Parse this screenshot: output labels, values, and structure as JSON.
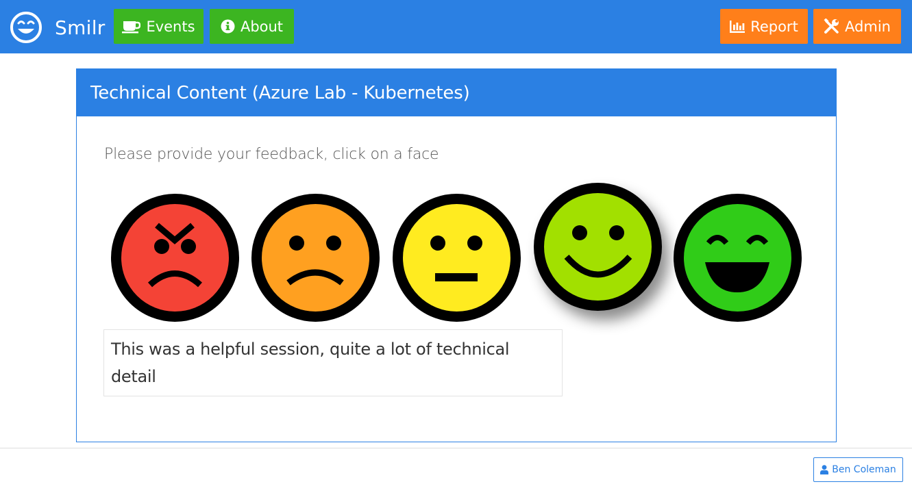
{
  "navbar": {
    "brand": "Smilr",
    "brand_logo_icon": "smiley-logo-icon",
    "buttons": {
      "events": {
        "label": "Events",
        "icon": "coffee-cup-icon"
      },
      "about": {
        "label": "About",
        "icon": "info-circle-icon"
      },
      "report": {
        "label": "Report",
        "icon": "bar-chart-icon"
      },
      "admin": {
        "label": "Admin",
        "icon": "tools-icon"
      }
    }
  },
  "card": {
    "title": "Technical Content (Azure Lab - Kubernetes)",
    "prompt": "Please provide your feedback, click on a face",
    "faces": [
      {
        "name": "angry",
        "color": "#f44336"
      },
      {
        "name": "sad",
        "color": "#ffa020"
      },
      {
        "name": "neutral",
        "color": "#ffeb20"
      },
      {
        "name": "happy",
        "color": "#a2e000",
        "selected": true
      },
      {
        "name": "very-happy",
        "color": "#30cc18"
      }
    ],
    "comment": "This was a helpful session, quite a lot of technical detail"
  },
  "footer": {
    "user_label": "Ben Coleman",
    "user_icon": "user-icon"
  },
  "colors": {
    "primary": "#2b80e3",
    "success": "#3cb521",
    "warning": "#ff7f1a"
  }
}
